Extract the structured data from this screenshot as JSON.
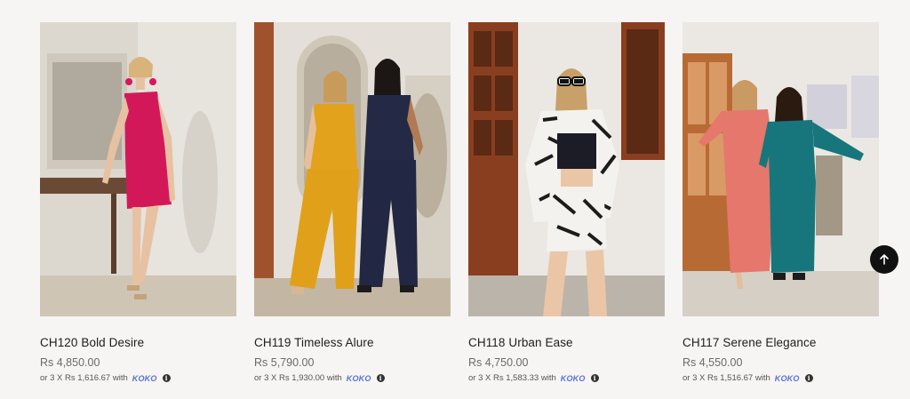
{
  "products": [
    {
      "name": "CH120 Bold Desire",
      "price": "Rs 4,850.00",
      "installment": "or 3 X Rs 1,616.67 with",
      "colors": {
        "wall": "#e6e2dc",
        "floor": "#c9c0b2",
        "garment": "#d3185a",
        "skin": "#e8c3a4",
        "hair": "#d8b47a"
      }
    },
    {
      "name": "CH119 Timeless Alure",
      "price": "Rs 5,790.00",
      "installment": "or 3 X Rs 1,930.00 with",
      "colors": {
        "wall": "#e3ded6",
        "floor": "#c2b6a2",
        "garment": "#e3a21c",
        "garment2": "#242a45",
        "skin": "#e5bf9b",
        "hair": "#c79a5a"
      }
    },
    {
      "name": "CH118 Urban Ease",
      "price": "Rs 4,750.00",
      "installment": "or 3 X Rs 1,583.33 with",
      "colors": {
        "wall": "#ebe8e3",
        "floor": "#b9b3aa",
        "garment": "#f4f2ee",
        "pattern": "#1c1c1c",
        "skin": "#eac6a6",
        "hair": "#c8a06a",
        "door": "#8a3e20"
      }
    },
    {
      "name": "CH117 Serene Elegance",
      "price": "Rs 4,550.00",
      "installment": "or 3 X Rs 1,516.67 with",
      "colors": {
        "wall": "#eceae6",
        "floor": "#d5cfc6",
        "garment": "#e5776c",
        "garment2": "#17767c",
        "skin": "#e4bd9b",
        "hair": "#8a5a2e"
      }
    }
  ],
  "payment_brand": "KOKO",
  "info_icon": "i",
  "scroll_top_icon": "arrow-up-icon"
}
